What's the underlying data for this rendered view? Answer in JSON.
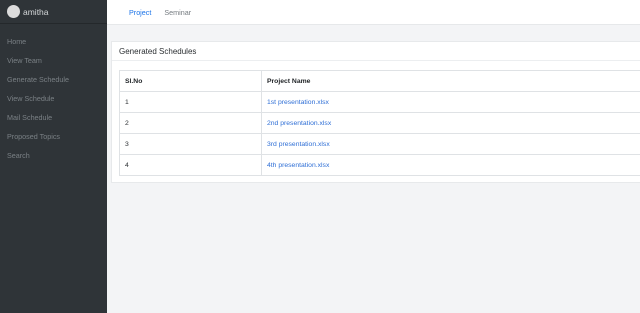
{
  "sidebar": {
    "username": "amitha",
    "items": [
      {
        "label": "Home"
      },
      {
        "label": "View Team"
      },
      {
        "label": "Generate Schedule"
      },
      {
        "label": "View Schedule"
      },
      {
        "label": "Mail Schedule"
      },
      {
        "label": "Proposed Topics"
      },
      {
        "label": "Search"
      }
    ]
  },
  "tabs": [
    {
      "label": "Project",
      "active": true
    },
    {
      "label": "Seminar",
      "active": false
    }
  ],
  "card": {
    "title": "Generated Schedules",
    "columns": [
      "Sl.No",
      "Project Name"
    ],
    "rows": [
      {
        "no": "1",
        "name": "1st presentation.xlsx"
      },
      {
        "no": "2",
        "name": "2nd presentation.xlsx"
      },
      {
        "no": "3",
        "name": "3rd presentation.xlsx"
      },
      {
        "no": "4",
        "name": "4th presentation.xlsx"
      }
    ]
  },
  "colors": {
    "sidebar_bg": "#2f3438",
    "accent": "#1a73e8",
    "link": "#2f6fd6"
  }
}
